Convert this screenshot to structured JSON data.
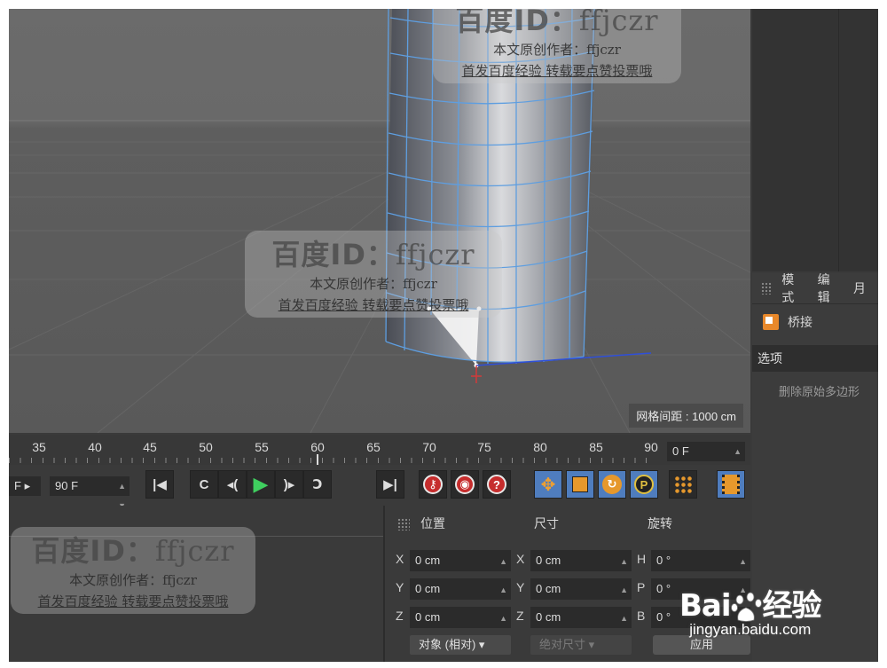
{
  "viewport": {
    "grid_spacing_label": "网格间距 : 1000 cm"
  },
  "timeline": {
    "ticks": [
      "35",
      "40",
      "45",
      "50",
      "55",
      "60",
      "65",
      "70",
      "75",
      "80",
      "85",
      "90"
    ],
    "current_frame": "0 F"
  },
  "transport": {
    "start_frame_partial": "F",
    "end_frame": "90 F"
  },
  "right_panel": {
    "menu": [
      "模式",
      "编辑",
      "月"
    ],
    "object_name": "桥接",
    "section_title": "选项",
    "option_label": "删除原始多边形"
  },
  "coordinates": {
    "headers": {
      "position": "位置",
      "size": "尺寸",
      "rotation": "旋转"
    },
    "rows": [
      {
        "axis1": "X",
        "pos": "0 cm",
        "axis2": "X",
        "size": "0 cm",
        "axis3": "H",
        "rot": "0 °"
      },
      {
        "axis1": "Y",
        "pos": "0 cm",
        "axis2": "Y",
        "size": "0 cm",
        "axis3": "P",
        "rot": "0 °"
      },
      {
        "axis1": "Z",
        "pos": "0 cm",
        "axis2": "Z",
        "size": "0 cm",
        "axis3": "B",
        "rot": "0 °"
      }
    ],
    "mode_dropdown": "对象 (相对)",
    "size_dropdown": "绝对尺寸",
    "apply_button": "应用"
  },
  "watermark": {
    "title_prefix": "百度ID：",
    "title_id": "ffjczr",
    "line1": "本文原创作者：ffjczr",
    "line2": "首发百度经验 转载要点赞投票哦"
  },
  "baidu_brand": {
    "logo_text": "Bai",
    "logo_text2": "经验",
    "domain": "jingyan.baidu.com"
  },
  "colors": {
    "accent_blue": "#4f7dbe",
    "record_red": "#c62d2d",
    "orange": "#e6982c",
    "play_green": "#3fcf5f"
  }
}
